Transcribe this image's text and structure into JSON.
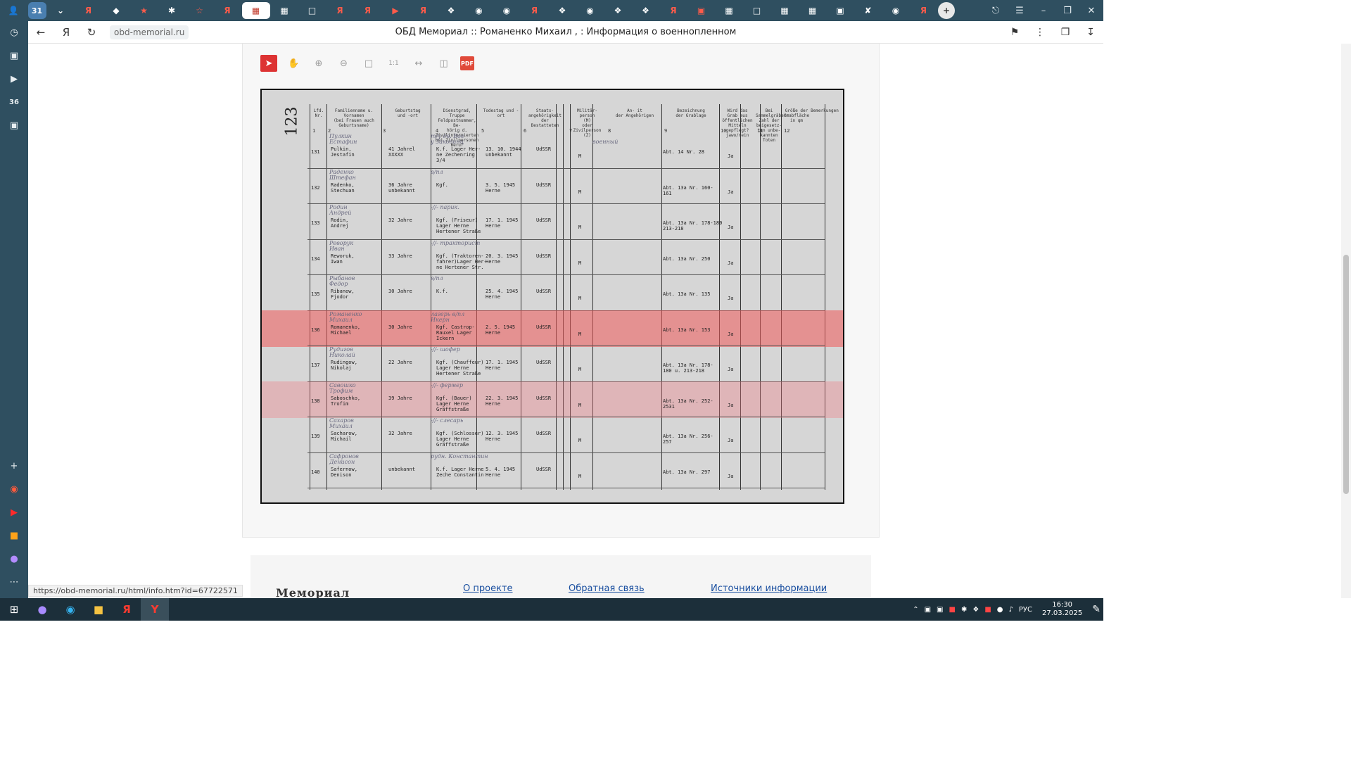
{
  "browser": {
    "tab_count_badge": "31",
    "page_title": "ОБД Мемориал :: Романенко Михаил , : Информация о военнопленном",
    "url": "obd-memorial.ru",
    "status_url": "https://obd-memorial.ru/html/info.htm?id=67722571"
  },
  "sidebar": {
    "badge": "36"
  },
  "document": {
    "page_number": "123",
    "headers": [
      {
        "num": "1",
        "label": "Lfd.\nNr."
      },
      {
        "num": "2",
        "label": "Familienname u. Vornamen\n(bei Frauen auch Geburtsname)"
      },
      {
        "num": "3",
        "label": "Geburtstag\nund -ort"
      },
      {
        "num": "4",
        "label": "Dienstgrad, Truppe\nFeldpostnummer, Be-\nhörig d. Zivilinternierten\nbei Zivilpersonen Beruf"
      },
      {
        "num": "5",
        "label": "Todestag und -ort"
      },
      {
        "num": "6",
        "label": "Staats-\nangehörigkeit\nder\nBestatteten"
      },
      {
        "num": "7",
        "label": "Militär-\nperson\n(M)\noder\nZivilperson\n(Z)"
      },
      {
        "num": "8",
        "label": "An-   it\nder Angehörigen"
      },
      {
        "num": "9",
        "label": "Bezeichnung\nder Grablage"
      },
      {
        "num": "10",
        "label": "Wird das\nGrab aus\nöffentlichen\nMitteln\ngepflegt?\njawo/nein"
      },
      {
        "num": "11",
        "label": "Bei Sammelgräbern\nZahl der\nbeigesetz-\nten unbe-\nkannten\nToten"
      },
      {
        "num": "12",
        "label": "Größe der\nGrabfläche\nin qm"
      },
      {
        "num": "",
        "label": "Bemerkungen"
      }
    ],
    "rows": [
      {
        "nr": "131",
        "hw": "Пулкин\nЕстафин",
        "name": "Pulkin,\nJestafin",
        "birth": "41 Jahrel\nXXXXX",
        "hw4": "т/у дв. Вое\nу Заковинц",
        "rank": "K.f. Lager Her-\nne Zechenring\n3/4",
        "death": "13. 10. 1944\nunbekannt",
        "nat": "UdSSR",
        "mil": "M",
        "hw8": "военный",
        "grave": "Abt. 14 Nr. 28",
        "care": "Ja"
      },
      {
        "nr": "132",
        "hw": "Раденко\nШтефан",
        "name": "Radenko,\nStechuan",
        "birth": "36 Jahre\nunbekannt",
        "hw4": "в/пл",
        "rank": "Kgf.",
        "death": "3. 5. 1945\nHerne",
        "nat": "UdSSR",
        "mil": "M",
        "hw8": "",
        "grave": "Abt. 13a Nr. 160-\n161",
        "care": "Ja"
      },
      {
        "nr": "133",
        "hw": "Родин\nАндрей",
        "name": "Rodin,\nAndrej",
        "birth": "32 Jahre",
        "hw4": "-//- парик.",
        "rank": "Kgf. (Friseur)\nLager Herne\nHertener Straße",
        "death": "17. 1. 1945\nHerne",
        "nat": "UdSSR",
        "mil": "M",
        "hw8": "",
        "grave": "Abt. 13a Nr. 178-180\n213-218",
        "care": "Ja"
      },
      {
        "nr": "134",
        "hw": "Реворук\nИван",
        "name": "Reworuk,\nIwan",
        "birth": "33 Jahre",
        "hw4": "-//- тракторист",
        "rank": "Kgf. (Traktoren-\nfahrer)Lager Her-\nne Hertener Str.",
        "death": "20. 3. 1945\nHerne",
        "nat": "UdSSR",
        "mil": "M",
        "hw8": "",
        "grave": "Abt. 13a Nr. 250",
        "care": "Ja"
      },
      {
        "nr": "135",
        "hw": "Рыбанов\nФедор",
        "name": "Ribanow,\nFjodor",
        "birth": "30 Jahre",
        "hw4": "в/пл",
        "rank": "K.f.",
        "death": "25. 4. 1945\nHerne",
        "nat": "UdSSR",
        "mil": "M",
        "hw8": "",
        "grave": "Abt. 13a Nr. 135",
        "care": "Ja"
      },
      {
        "nr": "136",
        "hw": "Романенко\nМихаил",
        "name": "Romanenko,\nMichael",
        "birth": "30 Jahre",
        "hw4": "лагерь в/пл\nИкерн",
        "rank": "Kgf. Castrop-\nRauxel Lager\nIckern",
        "death": "2. 5. 1945\nHerne",
        "nat": "UdSSR",
        "mil": "M",
        "hw8": "",
        "grave": "Abt. 13a Nr. 153",
        "care": "Ja"
      },
      {
        "nr": "137",
        "hw": "Рудигов\nНиколай",
        "name": "Rudingow,\nNikolaj",
        "birth": "22 Jahre",
        "hw4": "-//- шофер",
        "rank": "Kgf. (Chauffeur)\nLager Herne\nHertener Straße",
        "death": "17. 1. 1945\nHerne",
        "nat": "UdSSR",
        "mil": "M",
        "hw8": "",
        "grave": "Abt. 13a Nr. 178-\n180 u. 213-218",
        "care": "Ja"
      },
      {
        "nr": "138",
        "hw": "Савошко\nТрофим",
        "name": "Saboschko,\nTrofim",
        "birth": "39 Jahre",
        "hw4": "-//- фермер",
        "rank": "Kgf. (Bauer)\nLager Herne\nGräffstraße",
        "death": "22. 3. 1945\nHerne",
        "nat": "UdSSR",
        "mil": "M",
        "hw8": "",
        "grave": "Abt. 13a Nr. 252-\n2531",
        "care": "Ja"
      },
      {
        "nr": "139",
        "hw": "Сахаров\nМихаил",
        "name": "Sacharow,\nMichail",
        "birth": "32 Jahre",
        "hw4": "-//- слесарь",
        "rank": "Kgf. (Schlosser)\nLager Herne\nGräffstraße",
        "death": "12. 3. 1945\nHerne",
        "nat": "UdSSR",
        "mil": "M",
        "hw8": "",
        "grave": "Abt. 13a Nr. 256-\n257",
        "care": "Ja"
      },
      {
        "nr": "140",
        "hw": "Сафронов\nДенисон",
        "name": "Safernow,\nDenison",
        "birth": "unbekannt",
        "hw4": "рудн. Константин",
        "rank": "K.f. Lager Herne\nZeche Constantin",
        "death": "5. 4. 1945\nHerne",
        "nat": "UdSSR",
        "mil": "M",
        "hw8": "",
        "grave": "Abt. 13a Nr. 297",
        "care": "Ja"
      }
    ]
  },
  "footer": {
    "logo": "Мемориал",
    "links": [
      "О проекте",
      "Обратная связь",
      "Источники информации"
    ]
  },
  "taskbar": {
    "lang": "РУС",
    "time": "16:30",
    "date": "27.03.2025"
  }
}
